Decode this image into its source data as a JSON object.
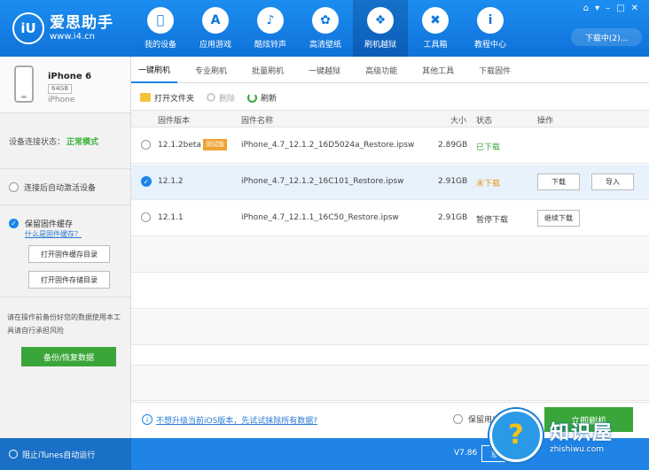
{
  "app": {
    "logo_mark": "iU",
    "name": "爱思助手",
    "url": "www.i4.cn"
  },
  "nav": [
    {
      "label": "我的设备",
      "icon": "apple-icon",
      "glyph": ""
    },
    {
      "label": "应用游戏",
      "icon": "appstore-icon",
      "glyph": "A"
    },
    {
      "label": "酷炫铃声",
      "icon": "bell-icon",
      "glyph": "♪"
    },
    {
      "label": "高清壁纸",
      "icon": "flower-icon",
      "glyph": "✿"
    },
    {
      "label": "刷机越狱",
      "icon": "dropbox-icon",
      "glyph": "❖"
    },
    {
      "label": "工具箱",
      "icon": "tools-icon",
      "glyph": "✖"
    },
    {
      "label": "教程中心",
      "icon": "info-icon",
      "glyph": "i"
    }
  ],
  "window_controls": [
    "⌂",
    "▾",
    "–",
    "□",
    "✕"
  ],
  "download_center": "下载中(2)...",
  "device": {
    "name": "iPhone 6",
    "capacity": "64GB",
    "type": "iPhone"
  },
  "connection": {
    "label": "设备连接状态：",
    "value": "正常模式",
    "value_color": "#3bb33b"
  },
  "auto_activate": "连接后自动激活设备",
  "cache": {
    "label": "保留固件缓存",
    "link": "什么是固件缓存？",
    "btn_open_cache": "打开固件缓存目录",
    "btn_open_storage": "打开固件存储目录"
  },
  "backup": {
    "note": "请在操作前备份好您的数据使用本工具请自行承担风险",
    "button": "备份/恢复数据"
  },
  "tabs": [
    "一键刷机",
    "专业刷机",
    "批量刷机",
    "一键越狱",
    "高级功能",
    "其他工具",
    "下载固件"
  ],
  "toolbar": {
    "open_folder": "打开文件夹",
    "delete": "删除",
    "refresh": "刷新"
  },
  "table": {
    "headers": {
      "version": "固件版本",
      "name": "固件名称",
      "size": "大小",
      "status": "状态",
      "action": "操作"
    },
    "rows": [
      {
        "version": "12.1.2beta",
        "badge": "测试版",
        "name": "iPhone_4.7_12.1.2_16D5024a_Restore.ipsw",
        "size": "2.89GB",
        "status": "已下载"
      },
      {
        "version": "12.1.2",
        "name": "iPhone_4.7_12.1.2_16C101_Restore.ipsw",
        "size": "2.91GB",
        "status": "未下载",
        "action1": "下载",
        "action2": "导入"
      },
      {
        "version": "12.1.1",
        "name": "iPhone_4.7_12.1.1_16C50_Restore.ipsw",
        "size": "2.91GB",
        "status": "暂停下载",
        "action1": "继续下载"
      }
    ]
  },
  "footer": {
    "info_link": "不想升级当前iOS版本，先试试抹除所有数据?",
    "keep_data": "保留用户",
    "flash_button": "立即刷机"
  },
  "statusbar": {
    "itunes": "阻止iTunes自动运行",
    "version": "V7.86",
    "button": "意"
  },
  "watermark": {
    "name": "知识屋",
    "url": "zhishiwu.com",
    "mark": "?"
  },
  "colors": {
    "accent": "#1a85e8",
    "success": "#3aa63a",
    "warning": "#e89a1a",
    "header": "#1580e6"
  }
}
